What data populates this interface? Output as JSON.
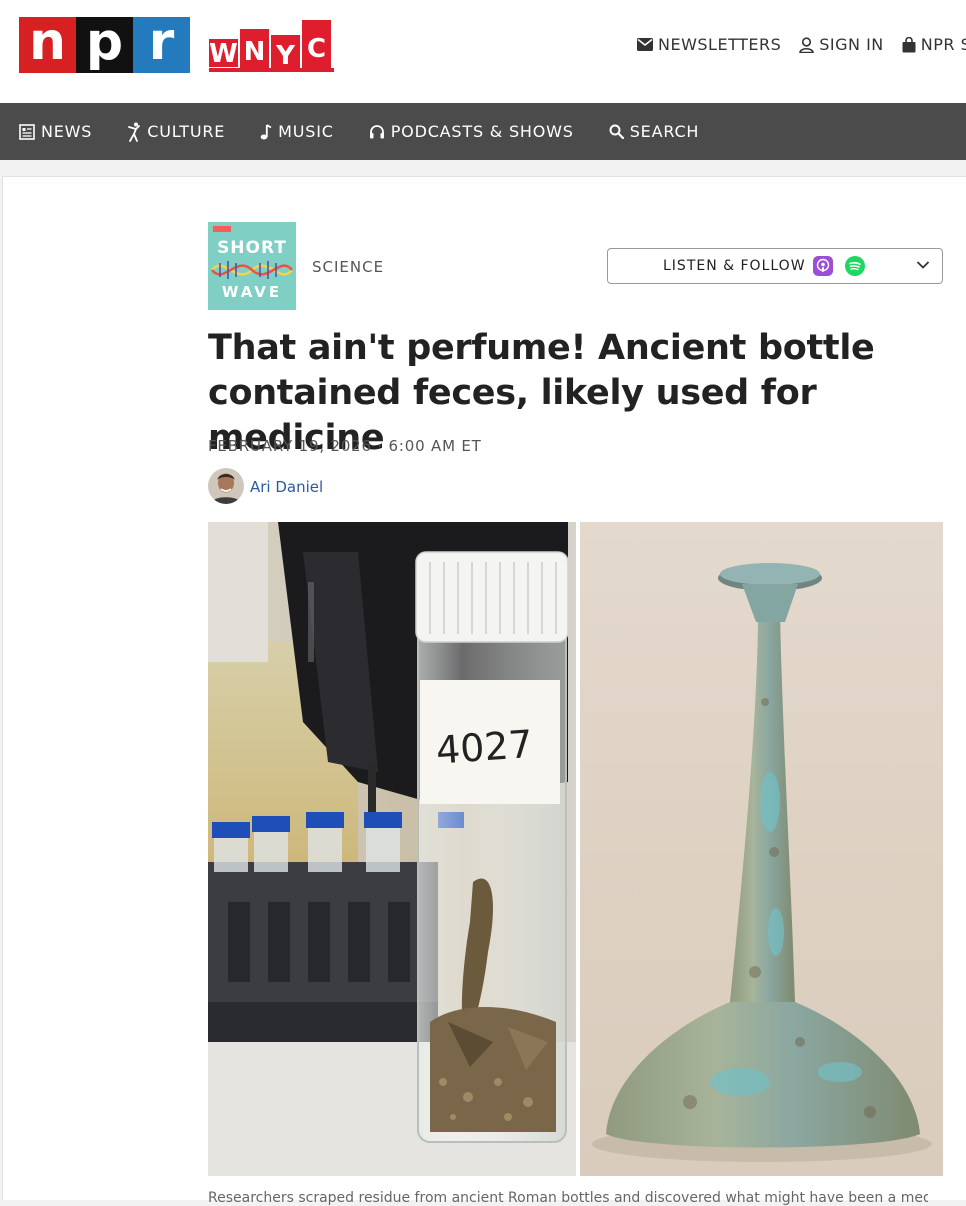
{
  "header": {
    "npr_letters": [
      "n",
      "p",
      "r"
    ],
    "wnyc_letters": [
      "W",
      "N",
      "Y",
      "C"
    ],
    "links": {
      "newsletters": "NEWSLETTERS",
      "sign_in": "SIGN IN",
      "shop": "NPR SH"
    }
  },
  "nav": {
    "news": "NEWS",
    "culture": "CULTURE",
    "music": "MUSIC",
    "podcasts": "PODCASTS & SHOWS",
    "search": "SEARCH"
  },
  "podcast": {
    "art_line1": "SHORT",
    "art_line2": "WAVE",
    "section": "SCIENCE",
    "listen_label": "LISTEN & FOLLOW"
  },
  "article": {
    "headline": "That ain't perfume! Ancient bottle contained feces, likely used for medicine",
    "dateline": "FEBRUARY 19, 2026 · 6:00 AM ET",
    "author": "Ari Daniel",
    "vial_label": "4027",
    "caption": "Researchers scraped residue from ancient Roman bottles and discovered what might have been a medical"
  },
  "colors": {
    "npr_red": "#d62021",
    "npr_black": "#111111",
    "npr_blue": "#237bbd",
    "wnyc_red": "#de1e2c",
    "nav_bg": "#4b4b4b",
    "author_link": "#2a5aa0"
  }
}
